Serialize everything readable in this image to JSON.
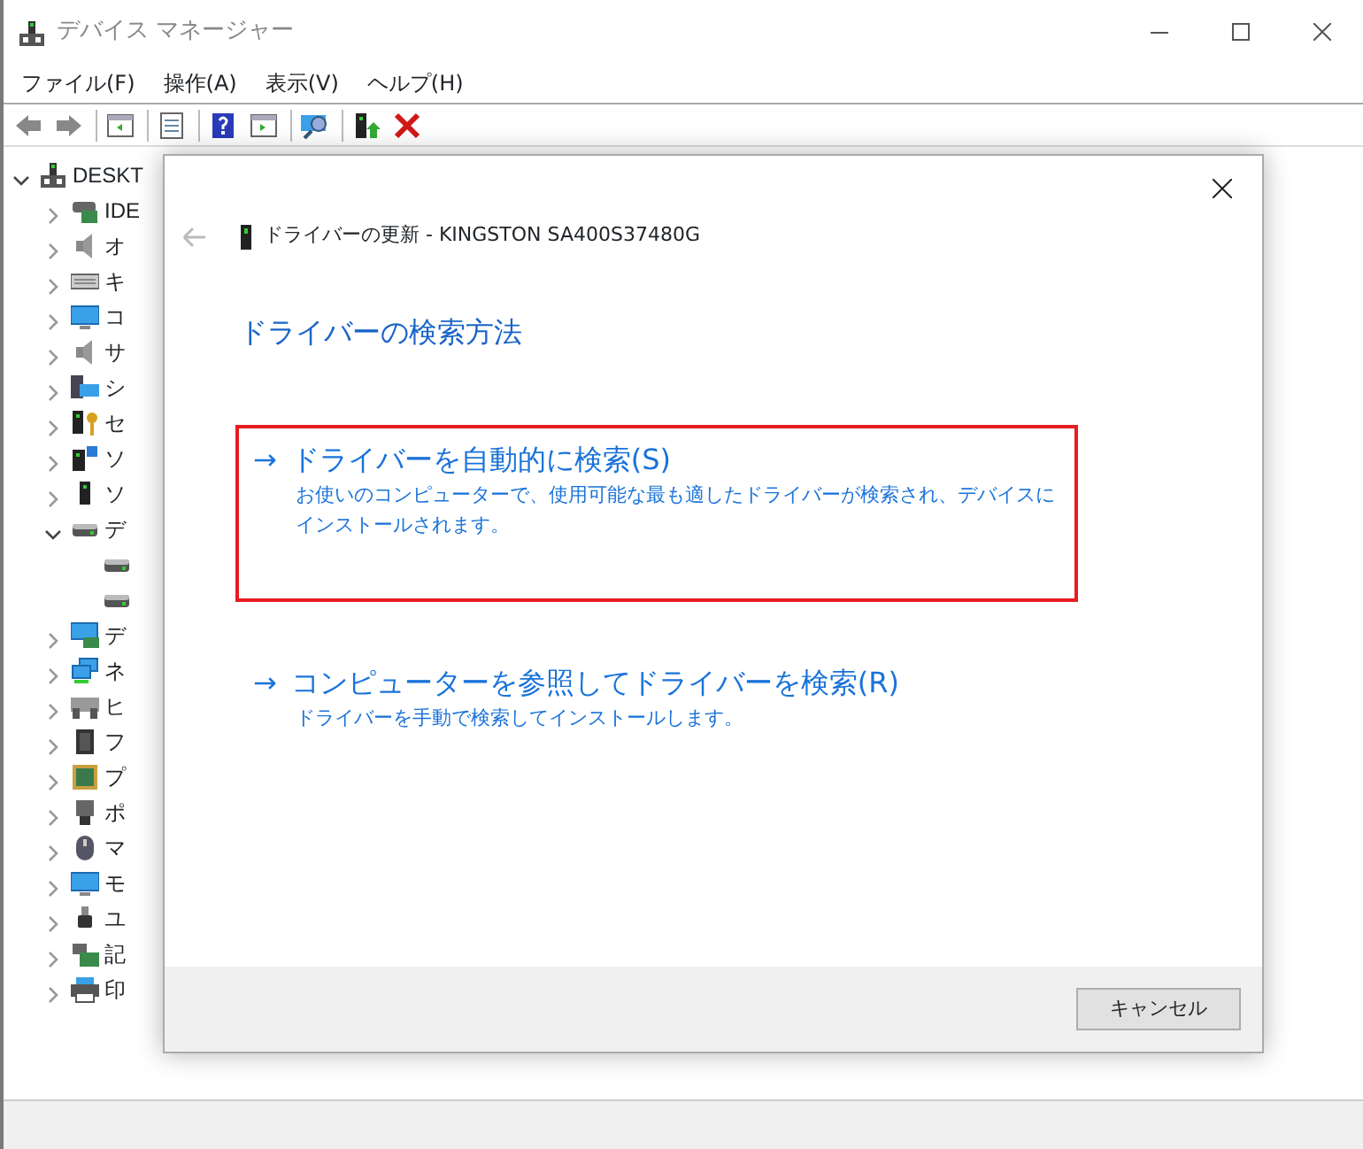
{
  "window": {
    "title": "デバイス マネージャー"
  },
  "menu": [
    "ファイル(F)",
    "操作(A)",
    "表示(V)",
    "ヘルプ(H)"
  ],
  "toolbar": [
    {
      "kind": "back"
    },
    {
      "kind": "forward"
    },
    {
      "kind": "sep"
    },
    {
      "kind": "tree"
    },
    {
      "kind": "sep"
    },
    {
      "kind": "properties"
    },
    {
      "kind": "sep"
    },
    {
      "kind": "help"
    },
    {
      "kind": "panel"
    },
    {
      "kind": "sep"
    },
    {
      "kind": "scan"
    },
    {
      "kind": "sep"
    },
    {
      "kind": "update"
    },
    {
      "kind": "remove"
    }
  ],
  "tree": {
    "label": "DESKT",
    "kind": "computer",
    "expanded": true,
    "children": [
      {
        "label": "IDE",
        "kind": "ide",
        "expanded": false
      },
      {
        "label": "オ",
        "kind": "audio",
        "expanded": false
      },
      {
        "label": "キ",
        "kind": "keyboard",
        "expanded": false
      },
      {
        "label": "コ",
        "kind": "monitor",
        "expanded": false
      },
      {
        "label": "サ",
        "kind": "audio",
        "expanded": false
      },
      {
        "label": "シ",
        "kind": "system",
        "expanded": false
      },
      {
        "label": "セ",
        "kind": "security",
        "expanded": false
      },
      {
        "label": "ソ",
        "kind": "software",
        "expanded": false
      },
      {
        "label": "ソ",
        "kind": "tower",
        "expanded": false
      },
      {
        "label": "デ",
        "kind": "drive",
        "expanded": true,
        "children": [
          {
            "kind": "drive"
          },
          {
            "kind": "drive"
          }
        ]
      },
      {
        "label": "デ",
        "kind": "display",
        "expanded": false
      },
      {
        "label": "ネ",
        "kind": "network",
        "expanded": false
      },
      {
        "label": "ヒ",
        "kind": "hid",
        "expanded": false
      },
      {
        "label": "フ",
        "kind": "chip",
        "expanded": false
      },
      {
        "label": "プ",
        "kind": "processor",
        "expanded": false
      },
      {
        "label": "ポ",
        "kind": "port",
        "expanded": false
      },
      {
        "label": "マ",
        "kind": "mouse",
        "expanded": false
      },
      {
        "label": "モ",
        "kind": "monitor",
        "expanded": false
      },
      {
        "label": "ユ",
        "kind": "usb",
        "expanded": false
      },
      {
        "label": "記",
        "kind": "storage",
        "expanded": false
      },
      {
        "label": "印",
        "kind": "printer",
        "expanded": false
      }
    ]
  },
  "dialog": {
    "back_disabled": true,
    "title": "ドライバーの更新 - KINGSTON SA400S37480G",
    "heading": "ドライバーの検索方法",
    "options": [
      {
        "arrow": "→",
        "title": "ドライバーを自動的に検索(S)",
        "description": "お使いのコンピューターで、使用可能な最も適したドライバーが検索され、デバイスにインストールされます。",
        "highlighted": true
      },
      {
        "arrow": "→",
        "title": "コンピューターを参照してドライバーを検索(R)",
        "description": "ドライバーを手動で検索してインストールします。",
        "highlighted": false
      }
    ],
    "buttons": [
      "キャンセル"
    ]
  }
}
